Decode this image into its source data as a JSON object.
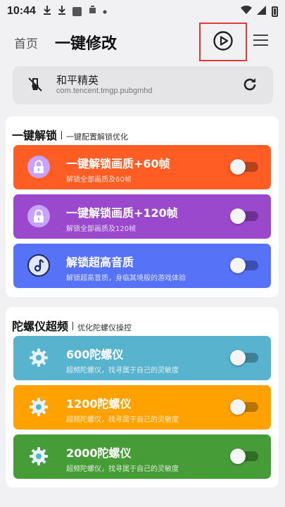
{
  "status_bar": {
    "time": "10:44",
    "icons": [
      "download-icon",
      "download-icon",
      "app-square-icon",
      "sim-icon",
      "dot-icon",
      "wifi-icon",
      "signal-icon",
      "battery-icon"
    ]
  },
  "header": {
    "home_label": "首页",
    "title": "一键修改",
    "play_icon": "play-circle-icon",
    "menu_icon": "menu-icon"
  },
  "selected_app": {
    "name": "和平精英",
    "package": "com.tencent.tmgp.pubgmhd",
    "icon": "mute-brush-icon",
    "refresh_icon": "refresh-icon"
  },
  "sections": [
    {
      "title": "一键解锁",
      "subtitle": "一键配置解锁优化",
      "items": [
        {
          "title": "一键解锁画质+60帧",
          "subtitle": "解锁全部画质及60帧",
          "icon": "lock-icon",
          "color": "#ff5d23",
          "on": false
        },
        {
          "title": "一键解锁画质+120帧",
          "subtitle": "解锁全部画质及120帧",
          "icon": "lock-icon",
          "color": "#9a49cd",
          "on": false
        },
        {
          "title": "解锁超高音质",
          "subtitle": "解锁超高音质，身临其境般的游戏体验",
          "icon": "music-note-icon",
          "color": "#5672f6",
          "on": false
        }
      ]
    },
    {
      "title": "陀螺仪超频",
      "subtitle": "优化陀螺仪操控",
      "items": [
        {
          "title": "600陀螺仪",
          "subtitle": "超频陀螺仪，找寻属于自己的灵敏度",
          "icon": "gear-icon",
          "color": "#58b3cf",
          "on": false
        },
        {
          "title": "1200陀螺仪",
          "subtitle": "超频陀螺仪，找寻属于自己的灵敏度",
          "icon": "gear-icon",
          "color": "#ffa200",
          "on": false
        },
        {
          "title": "2000陀螺仪",
          "subtitle": "超频陀螺仪，找寻属于自己的灵敏度",
          "icon": "gear-icon",
          "color": "#469c37",
          "on": false
        }
      ]
    }
  ]
}
